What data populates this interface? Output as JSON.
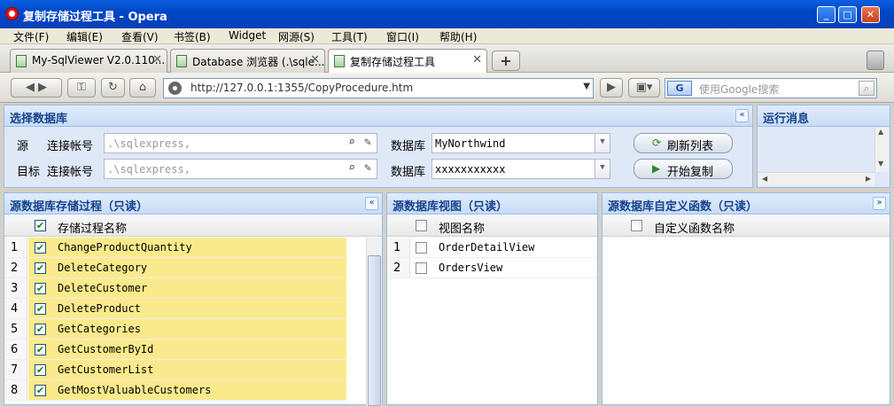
{
  "window": {
    "title": "复制存储过程工具 - Opera"
  },
  "menu": [
    "文件(F)",
    "编辑(E)",
    "查看(V)",
    "书签(B)",
    "Widget",
    "网源(S)",
    "工具(T)",
    "窗口(I)",
    "帮助(H)"
  ],
  "tabs": [
    {
      "label": "My-SqlViewer V2.0.110...",
      "active": false
    },
    {
      "label": "Database 浏览器 (.\\sqle...",
      "active": false
    },
    {
      "label": "复制存储过程工具",
      "active": true
    }
  ],
  "nav": {
    "url": "http://127.0.0.1:1355/CopyProcedure.htm",
    "search_placeholder": "使用Google搜索",
    "search_engine": "G"
  },
  "select_db": {
    "title": "选择数据库",
    "source_label": "源",
    "target_label": "目标",
    "account_label": "连接帐号",
    "source_account": ".\\sqlexpress,",
    "target_account": ".\\sqlexpress,",
    "db_label": "数据库",
    "source_db": "MyNorthwind",
    "target_db": "xxxxxxxxxxx",
    "refresh_button": "刷新列表",
    "copy_button": "开始复制"
  },
  "run_messages": {
    "title": "运行消息"
  },
  "procedures": {
    "title": "源数据库存储过程（只读）",
    "column": "存储过程名称",
    "rows": [
      {
        "num": "1",
        "name": "ChangeProductQuantity",
        "checked": true
      },
      {
        "num": "2",
        "name": "DeleteCategory",
        "checked": true
      },
      {
        "num": "3",
        "name": "DeleteCustomer",
        "checked": true
      },
      {
        "num": "4",
        "name": "DeleteProduct",
        "checked": true
      },
      {
        "num": "5",
        "name": "GetCategories",
        "checked": true
      },
      {
        "num": "6",
        "name": "GetCustomerById",
        "checked": true
      },
      {
        "num": "7",
        "name": "GetCustomerList",
        "checked": true
      },
      {
        "num": "8",
        "name": "GetMostValuableCustomers",
        "checked": true
      }
    ]
  },
  "views": {
    "title": "源数据库视图（只读）",
    "column": "视图名称",
    "rows": [
      {
        "num": "1",
        "name": "OrderDetailView",
        "checked": false
      },
      {
        "num": "2",
        "name": "OrdersView",
        "checked": false
      }
    ]
  },
  "functions": {
    "title": "源数据库自定义函数（只读）",
    "column": "自定义函数名称",
    "rows": []
  },
  "colors": {
    "accent": "#15428b",
    "selected_row": "#fbea8c",
    "title_blue": "#0047c8"
  }
}
